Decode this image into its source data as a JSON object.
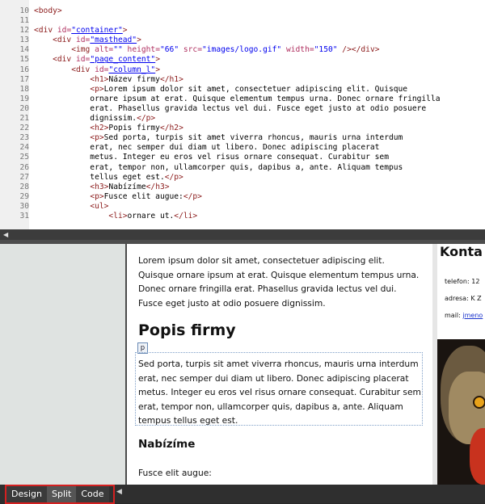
{
  "code": {
    "lines": [
      {
        "n": "10",
        "parts": [
          [
            "t",
            "<body>"
          ]
        ]
      },
      {
        "n": "11",
        "parts": []
      },
      {
        "n": "12",
        "parts": [
          [
            "t",
            "<div "
          ],
          [
            "a",
            "id="
          ],
          [
            "v",
            "\"container\""
          ],
          [
            "t",
            ">"
          ]
        ]
      },
      {
        "n": "13",
        "parts": [
          [
            "p",
            "    "
          ],
          [
            "t",
            "<div "
          ],
          [
            "a",
            "id="
          ],
          [
            "v",
            "\"masthead\""
          ],
          [
            "t",
            ">"
          ]
        ]
      },
      {
        "n": "14",
        "parts": [
          [
            "p",
            "        "
          ],
          [
            "t",
            "<img "
          ],
          [
            "a",
            "alt="
          ],
          [
            "s",
            "\"\""
          ],
          [
            "a",
            " height="
          ],
          [
            "s",
            "\"66\""
          ],
          [
            "a",
            " src="
          ],
          [
            "s",
            "\"images/logo.gif\""
          ],
          [
            "a",
            " width="
          ],
          [
            "s",
            "\"150\""
          ],
          [
            "t",
            " /></div>"
          ]
        ]
      },
      {
        "n": "15",
        "parts": [
          [
            "p",
            "    "
          ],
          [
            "t",
            "<div "
          ],
          [
            "a",
            "id="
          ],
          [
            "v",
            "\"page_content\""
          ],
          [
            "t",
            ">"
          ]
        ]
      },
      {
        "n": "16",
        "parts": [
          [
            "p",
            "        "
          ],
          [
            "t",
            "<div "
          ],
          [
            "a",
            "id="
          ],
          [
            "v",
            "\"column_l\""
          ],
          [
            "t",
            ">"
          ]
        ]
      },
      {
        "n": "17",
        "parts": [
          [
            "p",
            "            "
          ],
          [
            "t",
            "<h1>"
          ],
          [
            "p",
            "Název firmy"
          ],
          [
            "t",
            "</h1>"
          ]
        ]
      },
      {
        "n": "18",
        "parts": [
          [
            "p",
            "            "
          ],
          [
            "t",
            "<p>"
          ],
          [
            "p",
            "Lorem ipsum dolor sit amet, consectetuer adipiscing elit. Quisque"
          ]
        ]
      },
      {
        "n": "19",
        "parts": [
          [
            "p",
            "            ornare ipsum at erat. Quisque elementum tempus urna. Donec ornare fringilla"
          ]
        ]
      },
      {
        "n": "20",
        "parts": [
          [
            "p",
            "            erat. Phasellus gravida lectus vel dui. Fusce eget justo at odio posuere"
          ]
        ]
      },
      {
        "n": "21",
        "parts": [
          [
            "p",
            "            dignissim."
          ],
          [
            "t",
            "</p>"
          ]
        ]
      },
      {
        "n": "22",
        "parts": [
          [
            "p",
            "            "
          ],
          [
            "t",
            "<h2>"
          ],
          [
            "p",
            "Popis firmy"
          ],
          [
            "t",
            "</h2>"
          ]
        ]
      },
      {
        "n": "23",
        "parts": [
          [
            "p",
            "            "
          ],
          [
            "t",
            "<p>"
          ],
          [
            "p",
            "Sed porta, turpis sit amet viverra rhoncus, mauris urna interdum"
          ]
        ]
      },
      {
        "n": "24",
        "parts": [
          [
            "p",
            "            erat, nec semper dui diam ut libero. Donec adipiscing placerat"
          ]
        ]
      },
      {
        "n": "25",
        "parts": [
          [
            "p",
            "            metus. Integer eu eros vel risus ornare consequat. Curabitur sem"
          ]
        ]
      },
      {
        "n": "26",
        "parts": [
          [
            "p",
            "            erat, tempor non, ullamcorper quis, dapibus a, ante. Aliquam tempus"
          ]
        ]
      },
      {
        "n": "27",
        "parts": [
          [
            "p",
            "            tellus eget est."
          ],
          [
            "t",
            "</p>"
          ]
        ]
      },
      {
        "n": "28",
        "parts": [
          [
            "p",
            "            "
          ],
          [
            "t",
            "<h3>"
          ],
          [
            "p",
            "Nabízíme"
          ],
          [
            "t",
            "</h3>"
          ]
        ]
      },
      {
        "n": "29",
        "parts": [
          [
            "p",
            "            "
          ],
          [
            "t",
            "<p>"
          ],
          [
            "p",
            "Fusce elit augue:"
          ],
          [
            "t",
            "</p>"
          ]
        ]
      },
      {
        "n": "30",
        "parts": [
          [
            "p",
            "            "
          ],
          [
            "t",
            "<ul>"
          ]
        ]
      },
      {
        "n": "31",
        "parts": [
          [
            "p",
            "                "
          ],
          [
            "t",
            "<li>"
          ],
          [
            "p",
            "ornare ut."
          ],
          [
            "t",
            "</li>"
          ]
        ]
      }
    ]
  },
  "design": {
    "lorem": "Lorem ipsum dolor sit amet, consectetuer adipiscing elit. Quisque ornare ipsum at erat. Quisque elementum tempus urna. Donec ornare fringilla erat. Phasellus gravida lectus vel dui. Fusce eget justo at odio posuere dignissim.",
    "h2": "Popis firmy",
    "p_tag": "p",
    "sed": "Sed porta, turpis sit amet viverra rhoncus, mauris urna interdum erat, nec semper dui diam ut libero. Donec adipiscing placerat metus. Integer eu eros vel risus ornare consequat. Curabitur sem erat, tempor non, ullamcorper quis, dapibus a, ante. Aliquam tempus tellus eget est.",
    "h3": "Nabízíme",
    "fusce": "Fusce elit augue:",
    "contact": {
      "title": "Konta",
      "phone": "telefon: 12",
      "address": "adresa: K Z",
      "mail_label": "mail: ",
      "mail_link": "jmeno"
    }
  },
  "bottom_bar": {
    "design_label": "Design",
    "split_label": "Split",
    "code_label": "Code",
    "active": "Split"
  },
  "icons": {
    "hscroll_left": "triangle-left-icon",
    "bar_arrow": "triangle-left-icon"
  }
}
